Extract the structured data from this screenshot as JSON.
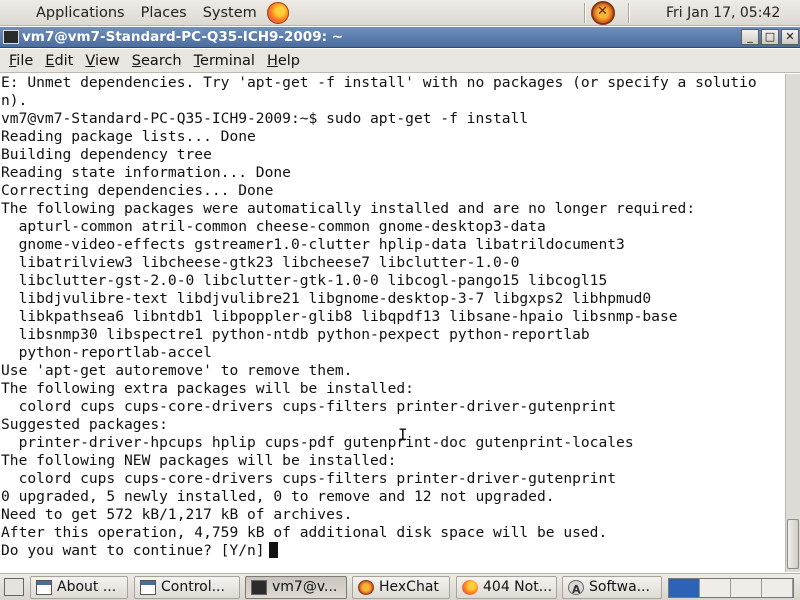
{
  "top_panel": {
    "menus": [
      "Applications",
      "Places",
      "System"
    ],
    "clock": "Fri Jan 17, 05:42"
  },
  "window": {
    "title": "vm7@vm7-Standard-PC-Q35-ICH9-2009: ~",
    "buttons": [
      "_",
      "□",
      "✕"
    ]
  },
  "menubar": [
    {
      "u": "F",
      "rest": "ile"
    },
    {
      "u": "E",
      "rest": "dit"
    },
    {
      "u": "V",
      "rest": "iew"
    },
    {
      "u": "S",
      "rest": "earch"
    },
    {
      "u": "T",
      "rest": "erminal"
    },
    {
      "u": "H",
      "rest": "elp"
    }
  ],
  "terminal": {
    "lines": [
      "E: Unmet dependencies. Try 'apt-get -f install' with no packages (or specify a solutio",
      "n).",
      "vm7@vm7-Standard-PC-Q35-ICH9-2009:~$ sudo apt-get -f install",
      "Reading package lists... Done",
      "Building dependency tree",
      "Reading state information... Done",
      "Correcting dependencies... Done",
      "The following packages were automatically installed and are no longer required:",
      "  apturl-common atril-common cheese-common gnome-desktop3-data",
      "  gnome-video-effects gstreamer1.0-clutter hplip-data libatrildocument3",
      "  libatrilview3 libcheese-gtk23 libcheese7 libclutter-1.0-0",
      "  libclutter-gst-2.0-0 libclutter-gtk-1.0-0 libcogl-pango15 libcogl15",
      "  libdjvulibre-text libdjvulibre21 libgnome-desktop-3-7 libgxps2 libhpmud0",
      "  libkpathsea6 libntdb1 libpoppler-glib8 libqpdf13 libsane-hpaio libsnmp-base",
      "  libsnmp30 libspectre1 python-ntdb python-pexpect python-reportlab",
      "  python-reportlab-accel",
      "Use 'apt-get autoremove' to remove them.",
      "The following extra packages will be installed:",
      "  colord cups cups-core-drivers cups-filters printer-driver-gutenprint",
      "Suggested packages:",
      "  printer-driver-hpcups hplip cups-pdf gutenprint-doc gutenprint-locales",
      "The following NEW packages will be installed:",
      "  colord cups cups-core-drivers cups-filters printer-driver-gutenprint",
      "0 upgraded, 5 newly installed, 0 to remove and 12 not upgraded.",
      "Need to get 572 kB/1,217 kB of archives.",
      "After this operation, 4,759 kB of additional disk space will be used.",
      "Do you want to continue? [Y/n]"
    ]
  },
  "taskbar": {
    "tasks": [
      {
        "label": "About ...",
        "icon": "window-icon"
      },
      {
        "label": "Control...",
        "icon": "window-icon"
      },
      {
        "label": "vm7@v...",
        "icon": "terminal-icon"
      },
      {
        "label": "HexChat",
        "icon": "hexchat-icon"
      },
      {
        "label": "404 Not...",
        "icon": "firefox-icon"
      },
      {
        "label": "Softwa...",
        "icon": "software-icon"
      }
    ]
  }
}
